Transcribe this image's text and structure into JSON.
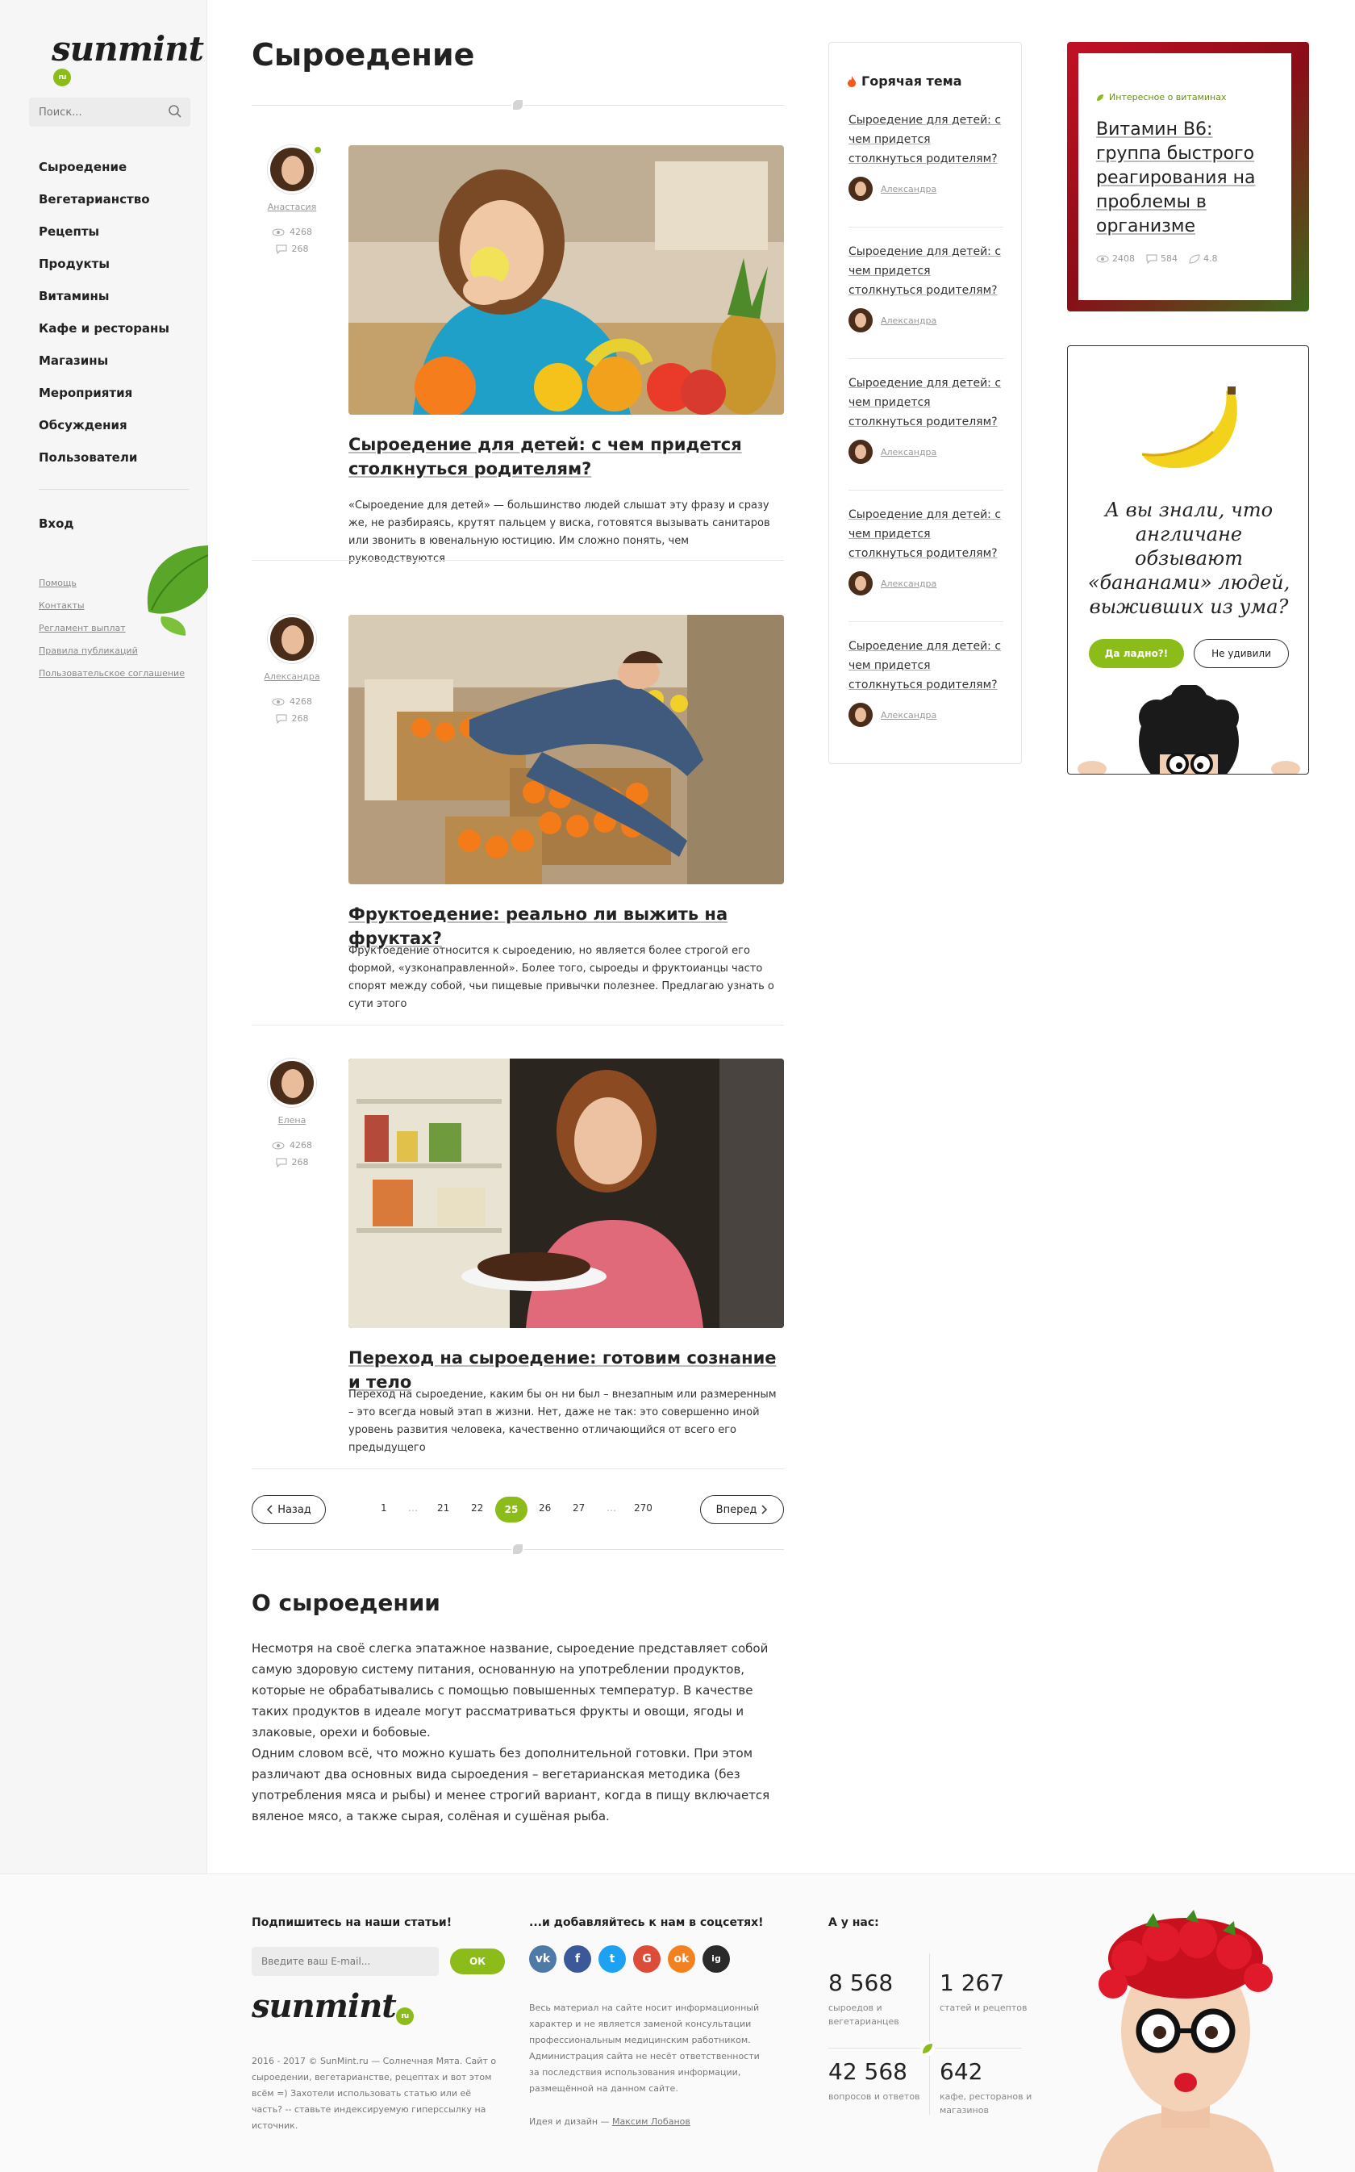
{
  "site": {
    "logo": "sunmint",
    "logo_badge": "ru"
  },
  "search": {
    "placeholder": "Поиск..."
  },
  "menu": [
    "Сыроедение",
    "Вегетарианство",
    "Рецепты",
    "Продукты",
    "Витамины",
    "Кафе и рестораны",
    "Магазины",
    "Мероприятия",
    "Обсуждения",
    "Пользователи"
  ],
  "login": "Вход",
  "sublinks": [
    "Помощь",
    "Контакты",
    "Регламент выплат",
    "Правила публикаций",
    "Пользовательское соглашение"
  ],
  "page_title": "Сыроедение",
  "articles": [
    {
      "author": "Анастасия",
      "views": "4268",
      "comments": "268",
      "title": "Сыроедение для детей: с чем придется столкнуться родителям?",
      "text": "«Сыроедение для детей» — большинство людей слышат эту фразу и сразу же, не разбираясь, крутят пальцем у виска, готовятся вызывать санитаров или звонить в ювенальную юстицию. Им сложно понять, чем руководствуются"
    },
    {
      "author": "Александра",
      "views": "4268",
      "comments": "268",
      "title": "Фруктоедение: реально ли выжить на фруктах?",
      "text": "Фруктоедение относится к сыроедению, но является более строгой его формой, «узконаправленной». Более того, сыроеды и фруктоианцы часто спорят между собой, чьи пищевые привычки полезнее. Предлагаю узнать о сути этого"
    },
    {
      "author": "Елена",
      "views": "4268",
      "comments": "268",
      "title": "Переход на сыроедение: готовим сознание и тело",
      "text": "Переход на сыроедение, каким бы он ни был – внезапным или размеренным – это всегда новый этап в жизни. Нет, даже не так: это совершенно иной уровень развития человека, качественно отличающийся от всего его предыдущего"
    }
  ],
  "pager": {
    "prev": "Назад",
    "next": "Вперед",
    "pages": [
      "1",
      "…",
      "21",
      "22",
      "25",
      "26",
      "27",
      "…",
      "270"
    ],
    "current": "25"
  },
  "about": {
    "title": "О сыроедении",
    "p1": "Несмотря на своё слегка эпатажное название, сыроедение представляет собой самую здоровую систему питания, основанную на употреблении продуктов, которые не обрабатывались с помощью повышенных температур. В качестве таких продуктов в идеале могут рассматриваться фрукты и овощи, ягоды и злаковые, орехи и бобовые.",
    "p2": "Одним словом всё, что можно кушать без дополнительной готовки. При этом различают два основных вида сыроедения – вегетарианская методика (без употребления мяса и рыбы) и менее строгий вариант, когда в пищу включается вяленое мясо, а также сырая, солёная и сушёная рыба."
  },
  "hot": {
    "title": "Горячая тема",
    "items": [
      {
        "q": "Сыроедение для детей: с чем придется столкнуться родителям?",
        "who": "Александра"
      },
      {
        "q": "Сыроедение для детей: с чем придется столкнуться родителям?",
        "who": "Александра"
      },
      {
        "q": "Сыроедение для детей: с чем придется столкнуться родителям?",
        "who": "Александра"
      },
      {
        "q": "Сыроедение для детей: с чем придется столкнуться родителям?",
        "who": "Александра"
      },
      {
        "q": "Сыроедение для детей: с чем придется столкнуться родителям?",
        "who": "Александра"
      }
    ]
  },
  "vitamin": {
    "tag": "Интересное о витаминах",
    "title": "Витамин B6: группа быстрого реагирования на проблемы в организме",
    "views": "2408",
    "comments": "584",
    "likes": "4.8"
  },
  "banana": {
    "text": "А вы знали, что англичане обзывают «бананами» людей, выживших из ума?",
    "yes": "Да ладно?!",
    "no": "Не удивили"
  },
  "footer": {
    "subscribe_title": "Подпишитесь на наши статьи!",
    "email_placeholder": "Введите ваш E-mail...",
    "ok": "ОК",
    "copyright": "2016 - 2017 © SunMint.ru — Солнечная Мята. Сайт о сыроедении, вегетарианстве, рецептах и вот этом всём =) Захотели использовать статью или её часть? -- ставьте индексируемую гиперссылку на источник.",
    "social_title": "...и добавляйтесь к нам в соцсетях!",
    "socials": [
      "vk",
      "f",
      "t",
      "G",
      "ok",
      "ig"
    ],
    "note": "Весь материал на сайте носит информационный характер и не является заменой консультации профессиональным медицинским работником. Администрация сайта не несёт ответственности за последствия использования информации, размещённой на данном сайте.",
    "design_prefix": "Идея и дизайн — ",
    "designer": "Максим Лобанов",
    "stats_title": "А у нас:",
    "stats": [
      {
        "n": "8 568",
        "l": "сыроедов и вегетарианцев"
      },
      {
        "n": "1 267",
        "l": "статей и рецептов"
      },
      {
        "n": "42 568",
        "l": "вопросов и ответов"
      },
      {
        "n": "642",
        "l": "кафе, ресторанов и магазинов"
      }
    ]
  },
  "colors": {
    "accent": "#8cbc1a",
    "text": "#222222"
  }
}
